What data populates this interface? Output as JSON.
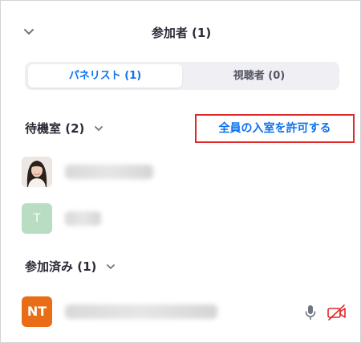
{
  "header": {
    "title": "参加者 (1)"
  },
  "tabs": [
    {
      "label": "パネリスト (1)",
      "active": true
    },
    {
      "label": "視聴者 (0)",
      "active": false
    }
  ],
  "waiting_room": {
    "label": "待機室 (2)",
    "admit_all_label": "全員の入室を許可する",
    "attendees": [
      {
        "avatar_type": "photo",
        "initials": ""
      },
      {
        "avatar_type": "initial",
        "initials": "T"
      }
    ]
  },
  "joined": {
    "label": "参加済み (1)",
    "attendees": [
      {
        "avatar_type": "initial",
        "initials": "NT",
        "mic_icon": "microphone-icon",
        "video_icon": "video-off-icon"
      }
    ]
  },
  "colors": {
    "accent": "#0e72ed",
    "highlight_border": "#e02828",
    "video_off": "#e02828",
    "avatar_nt": "#e86d16",
    "avatar_t": "#b8ddc2"
  }
}
